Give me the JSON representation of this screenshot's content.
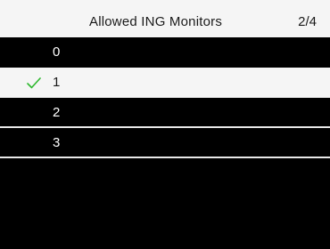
{
  "header": {
    "title": "Allowed ING Monitors",
    "page_indicator": "2/4"
  },
  "menu": {
    "items": [
      {
        "label": "0",
        "selected": false,
        "checked": false
      },
      {
        "label": "1",
        "selected": true,
        "checked": true
      },
      {
        "label": "2",
        "selected": false,
        "checked": false
      },
      {
        "label": "3",
        "selected": false,
        "checked": false
      }
    ]
  },
  "icons": {
    "check": "check-icon"
  },
  "colors": {
    "background": "#000000",
    "highlight": "#f5f5f5",
    "check": "#2eb82e",
    "text_dark": "#1a1a1a",
    "text_light": "#ffffff"
  }
}
